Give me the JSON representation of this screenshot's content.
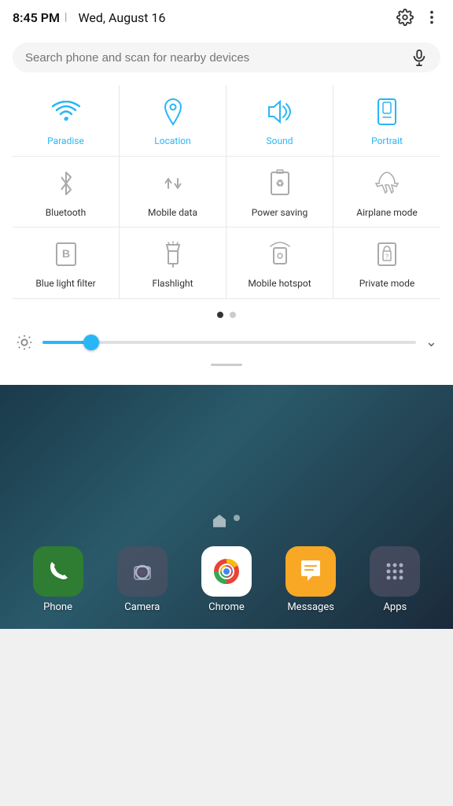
{
  "statusBar": {
    "time": "8:45 PM",
    "separator": "|",
    "date": "Wed, August 16"
  },
  "search": {
    "placeholder": "Search phone and scan for nearby devices"
  },
  "tilesRow1": [
    {
      "id": "wifi",
      "label": "Paradise",
      "active": true
    },
    {
      "id": "location",
      "label": "Location",
      "active": true
    },
    {
      "id": "sound",
      "label": "Sound",
      "active": true
    },
    {
      "id": "portrait",
      "label": "Portrait",
      "active": true
    }
  ],
  "tilesRow2": [
    {
      "id": "bluetooth",
      "label": "Bluetooth",
      "active": false
    },
    {
      "id": "mobile-data",
      "label": "Mobile data",
      "active": false
    },
    {
      "id": "power-saving",
      "label": "Power saving",
      "active": false
    },
    {
      "id": "airplane",
      "label": "Airplane mode",
      "active": false
    }
  ],
  "tilesRow3": [
    {
      "id": "blue-light",
      "label": "Blue light filter",
      "active": false
    },
    {
      "id": "flashlight",
      "label": "Flashlight",
      "active": false
    },
    {
      "id": "hotspot",
      "label": "Mobile hotspot",
      "active": false
    },
    {
      "id": "private",
      "label": "Private mode",
      "active": false
    }
  ],
  "pagination": {
    "dots": [
      true,
      false
    ]
  },
  "apps": [
    {
      "id": "phone",
      "label": "Phone"
    },
    {
      "id": "camera",
      "label": "Camera"
    },
    {
      "id": "chrome",
      "label": "Chrome"
    },
    {
      "id": "messages",
      "label": "Messages"
    },
    {
      "id": "apps",
      "label": "Apps"
    }
  ]
}
